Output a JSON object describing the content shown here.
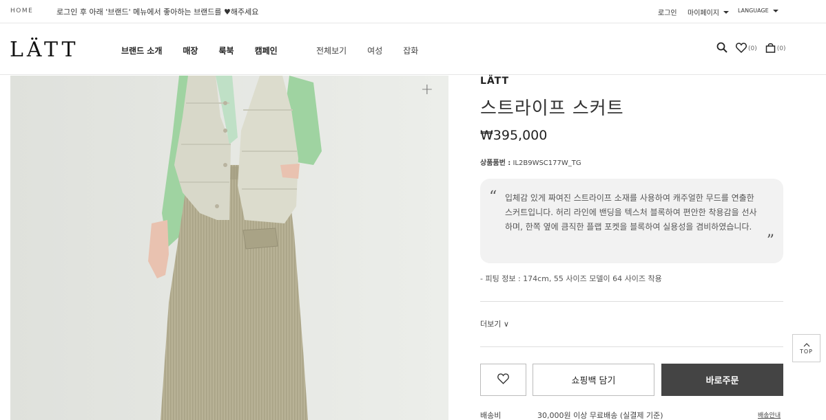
{
  "topbar": {
    "home": "HOME",
    "notice": "로그인 후 아래 '브랜드' 메뉴에서 좋아하는 브랜드를 ♥해주세요",
    "login": "로그인",
    "mypage": "마이페이지",
    "language": "LANGUAGE"
  },
  "header": {
    "logo": "LÄTT",
    "nav_main": [
      "브랜드 소개",
      "매장",
      "룩북",
      "캠페인"
    ],
    "nav_sub": [
      "전체보기",
      "여성",
      "잡화"
    ],
    "wish_count": "(0)",
    "cart_count": "(0)"
  },
  "product": {
    "brand": "LÄTT",
    "name": "스트라이프 스커트",
    "price": "₩395,000",
    "code_label": "상품품번 :",
    "code": "IL2B9WSC177W_TG",
    "quote_open": "“",
    "quote_close": "”",
    "description": "입체감 있게 짜여진 스트라이프 소재를 사용하여 캐주얼한 무드를 연출한 스커트입니다. 허리 라인에 밴딩을 텍스처 블록하여 편안한 착용감을 선사하며, 한쪽 옆에 큼직한 플랩 포켓을 블록하여 실용성을 겸비하였습니다.",
    "fit": "- 피팅 정보 : 174cm, 55 사이즈 모델이 64 사이즈 착용",
    "more": "더보기 ∨",
    "add_to_bag": "쇼핑백 담기",
    "buy_now": "바로주문",
    "shipping_label": "배송비",
    "shipping_value": "30,000원 이상 무료배송 (실결제 기준)",
    "shipping_link": "배송안내",
    "zoom": "+"
  },
  "floating": {
    "top": "TOP"
  },
  "colors": {
    "buy_button": "#444444",
    "desc_bg": "#f2f2f2",
    "image_bg": "#e7e8e4"
  },
  "icons": [
    "search-icon",
    "heart-icon",
    "bag-icon",
    "zoom-plus-icon",
    "chevron-up-icon"
  ]
}
